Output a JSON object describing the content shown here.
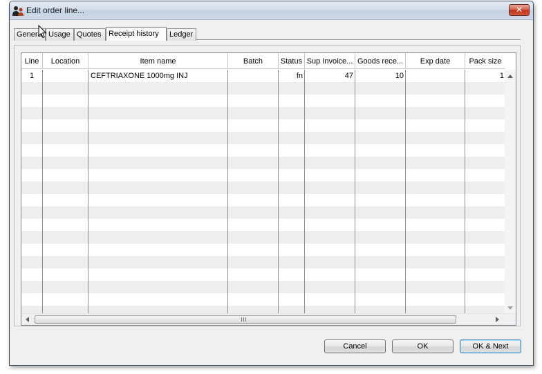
{
  "window": {
    "title": "Edit order line...",
    "close_symbol": "✕",
    "app_icon": "users-icon",
    "close_color": "#c0321a"
  },
  "tabs": [
    {
      "label": "General",
      "active": false
    },
    {
      "label": "Usage",
      "active": false
    },
    {
      "label": "Quotes",
      "active": false
    },
    {
      "label": "Receipt history",
      "active": true
    },
    {
      "label": "Ledger",
      "active": false
    }
  ],
  "grid": {
    "columns": [
      "Line",
      "Location",
      "Item name",
      "Batch",
      "Status",
      "Sup Invoice...",
      "Goods rece...",
      "Exp date",
      "Pack size"
    ],
    "rows": [
      {
        "line": "1",
        "location": "",
        "item_name": "CEFTRIAXONE 1000mg INJ",
        "batch": "",
        "status": "fn",
        "sup_invoice": "47",
        "goods_received": "10",
        "exp_date": "",
        "pack_size": "1"
      }
    ],
    "hscroll_grip": "Ⅲ"
  },
  "buttons": {
    "cancel": "Cancel",
    "ok": "OK",
    "ok_next": "OK & Next"
  }
}
